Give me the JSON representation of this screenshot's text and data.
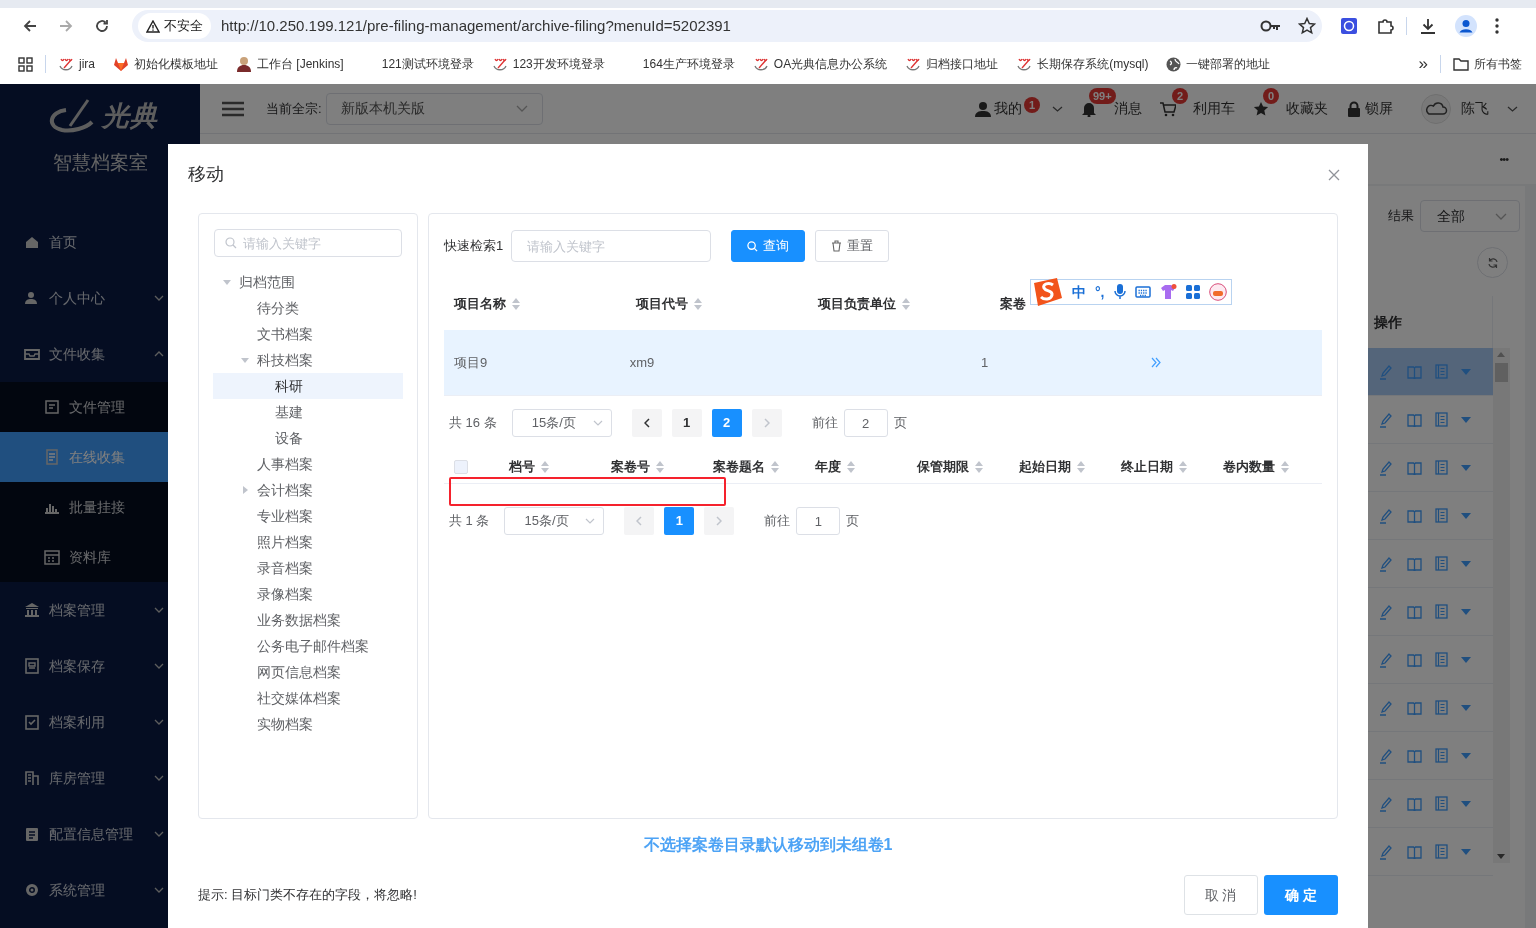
{
  "browser": {
    "can_go_forward": false,
    "security": "不安全",
    "url": "http://10.250.199.121/pre-filing-management/archive-filing?menuId=5202391",
    "bookmarks": [
      {
        "label": "jira"
      },
      {
        "label": "初始化模板地址"
      },
      {
        "label": "工作台 [Jenkins]"
      },
      {
        "label": "121测试环境登录"
      },
      {
        "label": "123开发环境登录"
      },
      {
        "label": "164生产环境登录"
      },
      {
        "label": "OA光典信息办公系统"
      },
      {
        "label": "归档接口地址"
      },
      {
        "label": "长期保存系统(mysql)"
      },
      {
        "label": "一键部署的地址"
      }
    ],
    "overflow": "»",
    "all_bookmarks": "所有书签"
  },
  "sidebar": {
    "brand": "光典",
    "subtitle": "智慧档案室",
    "items": [
      {
        "label": "首页",
        "kind": "link",
        "selected": false
      },
      {
        "label": "个人中心",
        "kind": "group",
        "expanded": false,
        "selected": false
      },
      {
        "label": "文件收集",
        "kind": "group",
        "expanded": true,
        "selected": false,
        "children": [
          {
            "label": "文件管理",
            "selected": false
          },
          {
            "label": "在线收集",
            "selected": true
          },
          {
            "label": "批量挂接",
            "selected": false
          },
          {
            "label": "资料库",
            "selected": false
          }
        ]
      },
      {
        "label": "档案管理",
        "kind": "group",
        "expanded": false,
        "selected": false
      },
      {
        "label": "档案保存",
        "kind": "group",
        "expanded": false,
        "selected": false
      },
      {
        "label": "档案利用",
        "kind": "group",
        "expanded": false,
        "selected": false
      },
      {
        "label": "库房管理",
        "kind": "group",
        "expanded": false,
        "selected": false
      },
      {
        "label": "配置信息管理",
        "kind": "group",
        "expanded": false,
        "selected": false
      },
      {
        "label": "系统管理",
        "kind": "group",
        "expanded": false,
        "selected": false
      }
    ]
  },
  "header": {
    "fonds_label": "当前全宗:",
    "fonds_value": "新版本机关版",
    "nav": [
      {
        "label": "我的",
        "badge": "1",
        "dropdown": true
      },
      {
        "label": "消息",
        "badge": "99+"
      },
      {
        "label": "利用车",
        "badge": "2"
      },
      {
        "label": "收藏夹",
        "badge": "0"
      },
      {
        "label": "锁屏"
      }
    ],
    "user": "陈飞"
  },
  "background_page": {
    "more": "•••",
    "filter_label": "结果",
    "filter_value": "全部",
    "column": "操作",
    "rows": [
      {
        "selected": true
      },
      {
        "selected": false
      },
      {
        "selected": false
      },
      {
        "selected": false
      },
      {
        "selected": false
      },
      {
        "selected": false
      },
      {
        "selected": false
      },
      {
        "selected": false
      },
      {
        "selected": false
      },
      {
        "selected": false
      },
      {
        "selected": false
      }
    ]
  },
  "dialog": {
    "title": "移动",
    "tree_search": {
      "placeholder": "请输入关键字"
    },
    "tree": [
      {
        "label": "归档范围",
        "expanded": true,
        "selected": false,
        "children": [
          {
            "label": "待分类",
            "selected": false
          },
          {
            "label": "文书档案",
            "selected": false
          },
          {
            "label": "科技档案",
            "expanded": true,
            "selected": false,
            "children": [
              {
                "label": "科研",
                "selected": true
              },
              {
                "label": "基建",
                "selected": false
              },
              {
                "label": "设备",
                "selected": false
              }
            ]
          },
          {
            "label": "人事档案",
            "selected": false
          },
          {
            "label": "会计档案",
            "expanded": false,
            "selected": false
          },
          {
            "label": "专业档案",
            "selected": false
          },
          {
            "label": "照片档案",
            "selected": false
          },
          {
            "label": "录音档案",
            "selected": false
          },
          {
            "label": "录像档案",
            "selected": false
          },
          {
            "label": "业务数据档案",
            "selected": false
          },
          {
            "label": "公务电子邮件档案",
            "selected": false
          },
          {
            "label": "网页信息档案",
            "selected": false
          },
          {
            "label": "社交媒体档案",
            "selected": false
          },
          {
            "label": "实物档案",
            "selected": false
          }
        ]
      }
    ],
    "quick_search": {
      "label": "快速检索1",
      "placeholder": "请输入关键字",
      "search_button": "查询",
      "reset_button": "重置"
    },
    "projects": {
      "columns": [
        "项目名称",
        "项目代号",
        "项目负责单位",
        "案卷"
      ],
      "rows": [
        {
          "name": "项目9",
          "code": "xm9",
          "count": "1",
          "selected": true
        }
      ]
    },
    "projects_pagination": {
      "total": "共 16 条",
      "page_size": "15条/页",
      "prev_disabled": false,
      "next_disabled": true,
      "pages": [
        {
          "label": "1",
          "selected": false
        },
        {
          "label": "2",
          "selected": true
        }
      ],
      "goto_label": "前往",
      "goto_value": "2",
      "page_suffix": "页"
    },
    "files": {
      "select_all": false,
      "columns": [
        "档号",
        "案卷号",
        "案卷题名",
        "年度",
        "保管期限",
        "起始日期",
        "终止日期",
        "卷内数量"
      ]
    },
    "files_pagination": {
      "total": "共 1 条",
      "page_size": "15条/页",
      "prev_disabled": true,
      "next_disabled": true,
      "pages": [
        {
          "label": "1",
          "selected": true
        }
      ],
      "goto_label": "前往",
      "goto_value": "1",
      "page_suffix": "页"
    },
    "note": "不选择案卷目录默认移动到未组卷1",
    "hint": "提示: 目标门类不存在的字段，将忽略!",
    "cancel_button": "取 消",
    "ok_button": "确 定"
  },
  "ime": {
    "mode": "中",
    "punctuation": "°,"
  }
}
